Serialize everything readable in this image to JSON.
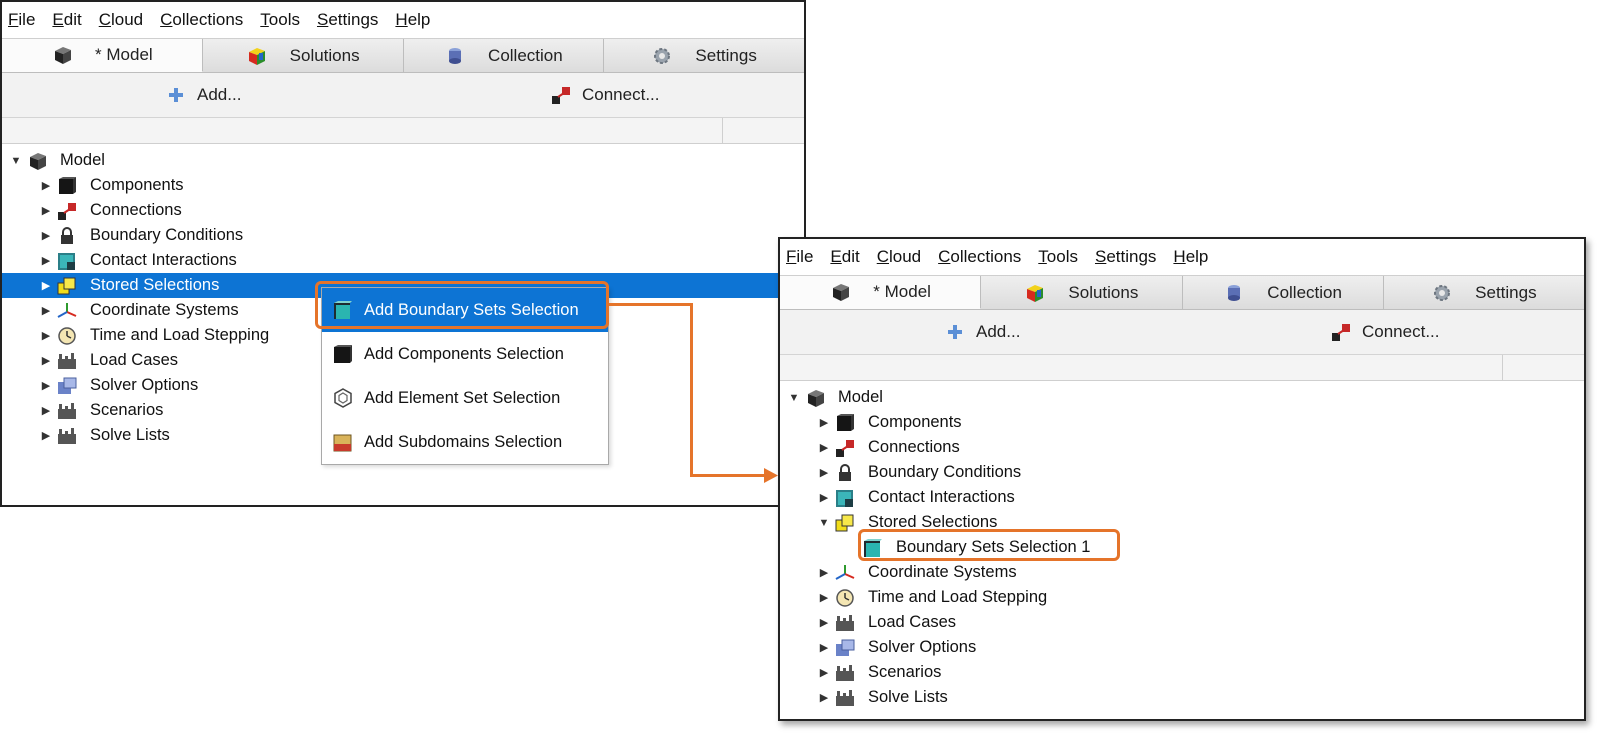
{
  "menus": [
    "File",
    "Edit",
    "Cloud",
    "Collections",
    "Tools",
    "Settings",
    "Help"
  ],
  "menu_underline": [
    "F",
    "E",
    "C",
    "C",
    "T",
    "S",
    "H"
  ],
  "tabs": [
    {
      "label": "* Model",
      "icon": "model-cube-icon",
      "active": true
    },
    {
      "label": "Solutions",
      "icon": "solutions-cube-icon",
      "active": false
    },
    {
      "label": "Collection",
      "icon": "collection-icon",
      "active": false
    },
    {
      "label": "Settings",
      "icon": "settings-gear-icon",
      "active": false
    }
  ],
  "toolbar": {
    "add_label": "Add...",
    "connect_label": "Connect..."
  },
  "left": {
    "root": "Model",
    "items": [
      {
        "label": "Components",
        "icon": "components-icon"
      },
      {
        "label": "Connections",
        "icon": "connections-icon"
      },
      {
        "label": "Boundary Conditions",
        "icon": "lock-icon"
      },
      {
        "label": "Contact Interactions",
        "icon": "contact-interactions-icon"
      },
      {
        "label": "Stored Selections",
        "icon": "stored-selections-icon",
        "selected": true
      },
      {
        "label": "Coordinate Systems",
        "icon": "coordinate-systems-icon"
      },
      {
        "label": "Time and Load Stepping",
        "icon": "time-stepping-icon"
      },
      {
        "label": "Load Cases",
        "icon": "load-cases-icon"
      },
      {
        "label": "Solver Options",
        "icon": "solver-options-icon"
      },
      {
        "label": "Scenarios",
        "icon": "scenarios-icon"
      },
      {
        "label": "Solve Lists",
        "icon": "solve-lists-icon"
      }
    ]
  },
  "context_menu": [
    {
      "label": "Add Boundary Sets Selection",
      "icon": "boundary-sets-icon",
      "highlighted": true
    },
    {
      "label": "Add Components Selection",
      "icon": "components-selection-icon"
    },
    {
      "label": "Add Element Set Selection",
      "icon": "element-set-icon"
    },
    {
      "label": "Add Subdomains Selection",
      "icon": "subdomains-icon"
    }
  ],
  "right": {
    "root": "Model",
    "new_child": "Boundary Sets Selection 1"
  },
  "colors": {
    "selection": "#0d74d4",
    "callout": "#e5742a"
  }
}
